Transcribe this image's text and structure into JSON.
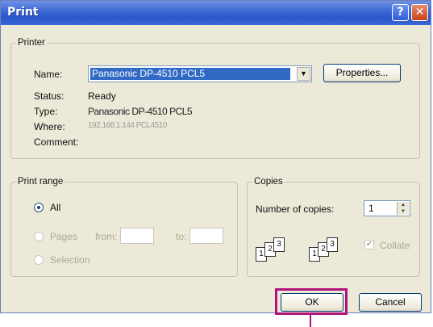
{
  "window": {
    "title": "Print"
  },
  "titlebar": {
    "help_glyph": "?",
    "close_glyph": "✕"
  },
  "printer": {
    "group_label": "Printer",
    "name_label": "Name:",
    "name_value": "Panasonic DP-4510 PCL5",
    "properties_label": "Properties...",
    "status_label": "Status:",
    "status_value": "Ready",
    "type_label": "Type:",
    "type_value": "Panasonic DP-4510 PCL5",
    "where_label": "Where:",
    "where_value": "192.168.1.144 PCL4510",
    "comment_label": "Comment:",
    "comment_value": ""
  },
  "print_range": {
    "group_label": "Print range",
    "all_label": "All",
    "pages_label": "Pages",
    "from_label": "from:",
    "to_label": "to:",
    "from_value": "",
    "to_value": "",
    "selection_label": "Selection",
    "selected": "All"
  },
  "copies": {
    "group_label": "Copies",
    "number_label": "Number of copies:",
    "number_value": "1",
    "collate_label": "Collate",
    "collate_checked": true,
    "collate_icon_1": [
      "1",
      "2",
      "3"
    ],
    "collate_icon_2": [
      "1",
      "2",
      "3"
    ]
  },
  "buttons": {
    "ok_label": "OK",
    "cancel_label": "Cancel"
  },
  "colors": {
    "titlebar": "#2a57cc",
    "dialog_bg": "#ece9d8",
    "highlight": "#b0147a",
    "selection": "#316ac5"
  }
}
